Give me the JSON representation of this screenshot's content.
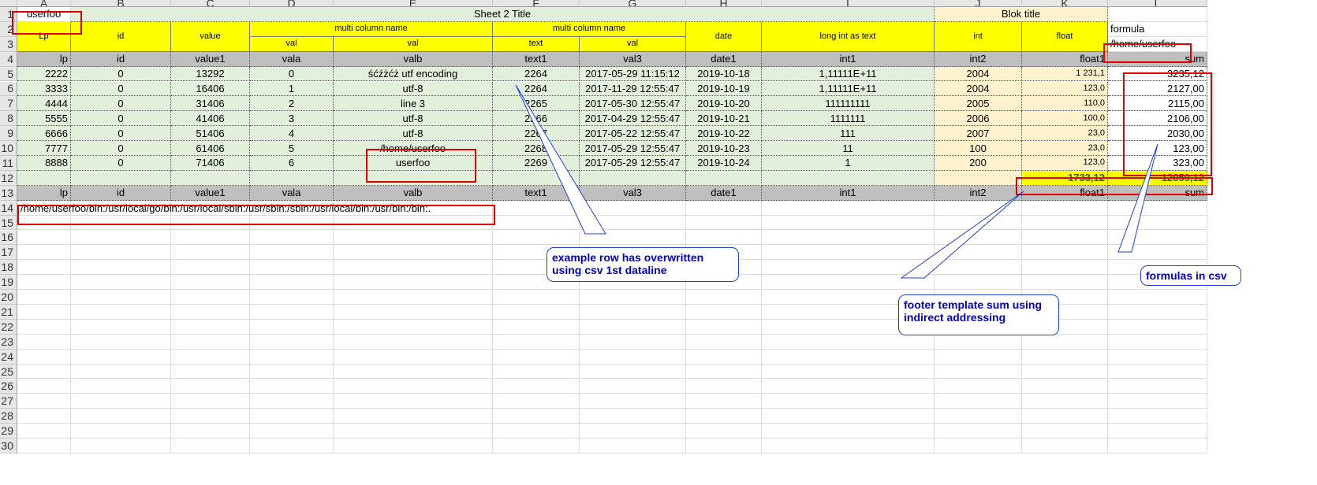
{
  "columns": [
    "A",
    "B",
    "C",
    "D",
    "E",
    "F",
    "G",
    "H",
    "I",
    "J",
    "K",
    "L"
  ],
  "rows": [
    "1",
    "2",
    "3",
    "4",
    "5",
    "6",
    "7",
    "8",
    "9",
    "10",
    "11",
    "12",
    "13",
    "14",
    "15",
    "16",
    "17",
    "18",
    "19",
    "20",
    "21",
    "22",
    "23",
    "24",
    "25",
    "26",
    "27",
    "28",
    "29",
    "30"
  ],
  "cells": {
    "a1": "userfoo",
    "sheet_title": "Sheet  2 Title",
    "blok_title": "Blok title",
    "h_lp": "Lp",
    "h_id": "id",
    "h_value": "value",
    "h_multi1": "multi column name",
    "h_multi2": "multi column name",
    "h_date": "date",
    "h_longint": "long int as text",
    "h_int": "int",
    "h_float": "float",
    "h_formula": "formula",
    "s_val_d": "val",
    "s_val_e": "val",
    "s_text_f": "text",
    "s_val_g": "val",
    "l3": "/home/userfoo",
    "path14": "/home/userfoo/bin:/usr/local/go/bin:/usr/local/sbin:/usr/sbin:/sbin:/usr/local/bin:/usr/bin:/bin:."
  },
  "field_row": [
    "lp",
    "id",
    "value1",
    "vala",
    "valb",
    "text1",
    "val3",
    "date1",
    "int1",
    "int2",
    "float1",
    "sum"
  ],
  "data_rows": [
    [
      "2222",
      "0",
      "13292",
      "0",
      "śćźżćż utf encoding",
      "2264",
      "2017-05-29 11:15:12",
      "2019-10-18",
      "1,11111E+11",
      "2004",
      "1 231,1",
      "3235,12"
    ],
    [
      "3333",
      "0",
      "16406",
      "1",
      "utf-8",
      "2264",
      "2017-11-29 12:55:47",
      "2019-10-19",
      "1,11111E+11",
      "2004",
      "123,0",
      "2127,00"
    ],
    [
      "4444",
      "0",
      "31406",
      "2",
      "line 3",
      "2265",
      "2017-05-30 12:55:47",
      "2019-10-20",
      "111111111",
      "2005",
      "110,0",
      "2115,00"
    ],
    [
      "5555",
      "0",
      "41406",
      "3",
      "utf-8",
      "2266",
      "2017-04-29 12:55:47",
      "2019-10-21",
      "1111111",
      "2006",
      "100,0",
      "2106,00"
    ],
    [
      "6666",
      "0",
      "51406",
      "4",
      "utf-8",
      "2267",
      "2017-05-22 12:55:47",
      "2019-10-22",
      "111",
      "2007",
      "23,0",
      "2030,00"
    ],
    [
      "7777",
      "0",
      "61406",
      "5",
      "/home/userfoo",
      "2268",
      "2017-05-29 12:55:47",
      "2019-10-23",
      "11",
      "100",
      "23,0",
      "123,00"
    ],
    [
      "8888",
      "0",
      "71406",
      "6",
      "userfoo",
      "2269",
      "2017-05-29 12:55:47",
      "2019-10-24",
      "1",
      "200",
      "123,0",
      "323,00"
    ]
  ],
  "sums": {
    "float": "1733,12",
    "total": "12059,12"
  },
  "callouts": {
    "example": "example row has overwritten using csv 1st dataline",
    "footer": "footer template sum using indirect addressing",
    "formulas": "formulas in csv"
  },
  "colors": {
    "green": "#e2efda",
    "yellow": "#ffff00",
    "peach": "#fff2cc",
    "grey": "#bfbfbf",
    "red": "#e00000",
    "blue": "#1f3fd8"
  }
}
